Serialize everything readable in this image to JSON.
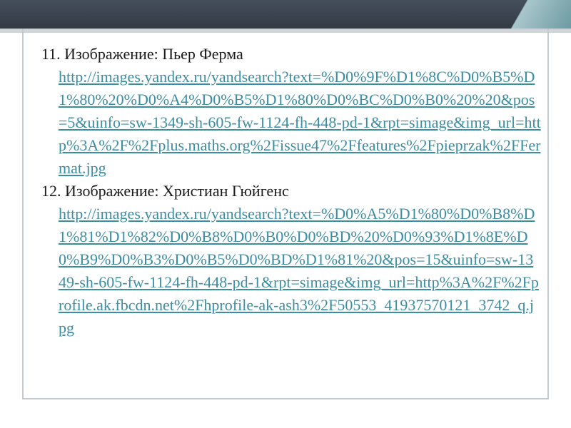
{
  "slide": {
    "entries": [
      {
        "title": "11. Изображение: Пьер Ферма",
        "url": "http://images.yandex.ru/yandsearch?text=%D0%9F%D1%8C%D0%B5%D1%80%20%D0%A4%D0%B5%D1%80%D0%BC%D0%B0%20%20&pos=5&uinfo=sw-1349-sh-605-fw-1124-fh-448-pd-1&rpt=simage&img_url=http%3A%2F%2Fplus.maths.org%2Fissue47%2Ffeatures%2Fpieprzak%2FFermat.jpg"
      },
      {
        "title": "12. Изображение:  Христиан Гюйгенс",
        "url": "http://images.yandex.ru/yandsearch?text=%D0%A5%D1%80%D0%B8%D1%81%D1%82%D0%B8%D0%B0%D0%BD%20%D0%93%D1%8E%D0%B9%D0%B3%D0%B5%D0%BD%D1%81%20&pos=15&uinfo=sw-1349-sh-605-fw-1124-fh-448-pd-1&rpt=simage&img_url=http%3A%2F%2Fprofile.ak.fbcdn.net%2Fhprofile-ak-ash3%2F50553_41937570121_3742_q.jpg"
      }
    ]
  }
}
